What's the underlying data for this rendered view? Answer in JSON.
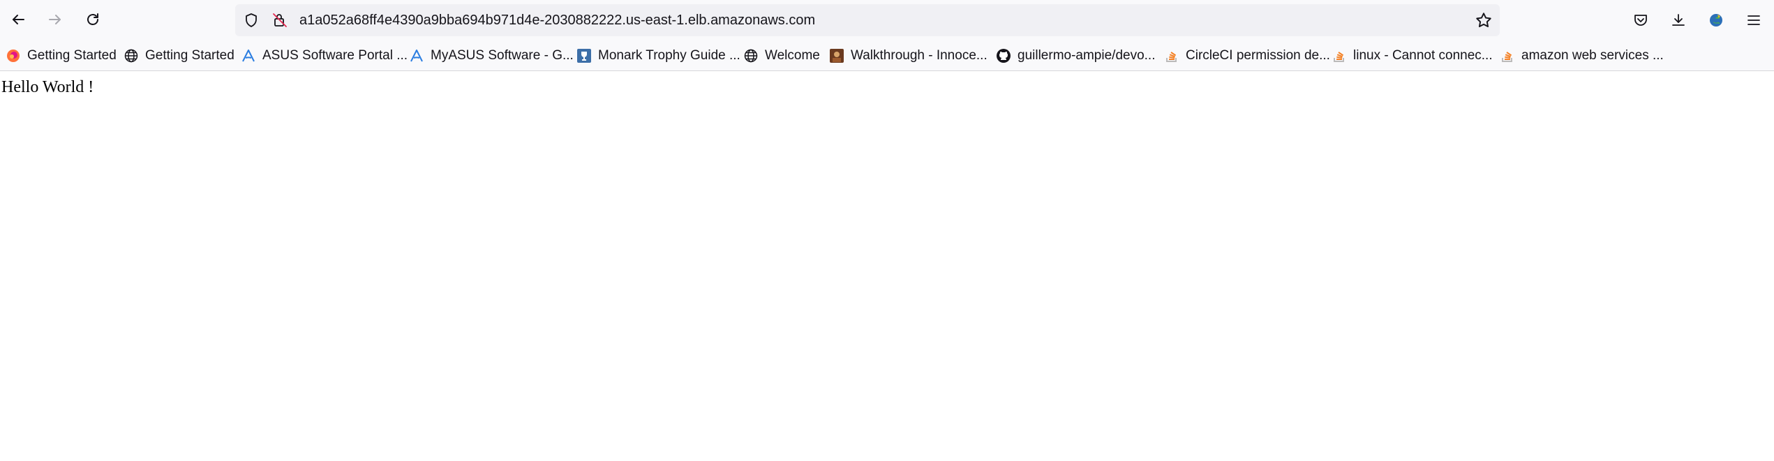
{
  "browser": {
    "url": "a1a052a68ff4e4390a9bba694b971d4e-2030882222.us-east-1.elb.amazonaws.com",
    "bookmarks": [
      {
        "label": "Getting Started",
        "icon": "firefox-icon"
      },
      {
        "label": "Getting Started",
        "icon": "globe-icon"
      },
      {
        "label": "ASUS Software Portal ...",
        "icon": "asus-icon"
      },
      {
        "label": "MyASUS Software - G...",
        "icon": "asus-icon"
      },
      {
        "label": "Monark Trophy Guide ...",
        "icon": "trophy-icon"
      },
      {
        "label": "Welcome",
        "icon": "globe-icon"
      },
      {
        "label": "Walkthrough - Innoce...",
        "icon": "portrait-icon"
      },
      {
        "label": "guillermo-ampie/devo...",
        "icon": "github-icon"
      },
      {
        "label": "CircleCI permission de...",
        "icon": "stackoverflow-icon"
      },
      {
        "label": "linux - Cannot connec...",
        "icon": "stackoverflow-icon"
      },
      {
        "label": "amazon web services ...",
        "icon": "stackoverflow-icon"
      }
    ]
  },
  "page": {
    "text": "Hello World !"
  },
  "colors": {
    "toolbar_bg": "#f9f9fb",
    "urlbar_bg": "#f0f0f4",
    "stackoverflow_orange": "#f48024",
    "asus_blue": "#2a7de1"
  }
}
